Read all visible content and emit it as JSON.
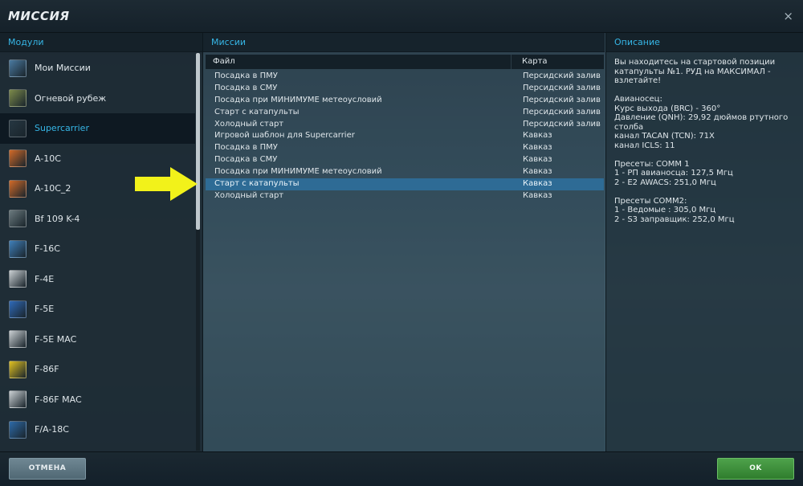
{
  "window": {
    "title": "МИССИЯ",
    "close_glyph": "×"
  },
  "modules": {
    "header": "Модули",
    "items": [
      {
        "label": "Мои Миссии",
        "icon": "my-missions-icon",
        "color": "#4a7aa0",
        "selected": false
      },
      {
        "label": "Огневой рубеж",
        "icon": "firing-range-icon",
        "color": "#7c8a4a",
        "selected": false
      },
      {
        "label": "Supercarrier",
        "icon": "supercarrier-icon",
        "color": "#263742",
        "selected": true
      },
      {
        "label": "A-10C",
        "icon": "a10c-icon",
        "color": "#d16a28",
        "selected": false
      },
      {
        "label": "A-10C_2",
        "icon": "a10c2-icon",
        "color": "#d16a28",
        "selected": false
      },
      {
        "label": "Bf 109 K-4",
        "icon": "bf109-icon",
        "color": "#6b7a7e",
        "selected": false
      },
      {
        "label": "F-16C",
        "icon": "f16c-icon",
        "color": "#3f7fb8",
        "selected": false
      },
      {
        "label": "F-4E",
        "icon": "f4e-icon",
        "color": "#c9cfd2",
        "selected": false
      },
      {
        "label": "F-5E",
        "icon": "f5e-icon",
        "color": "#2f6ab8",
        "selected": false
      },
      {
        "label": "F-5E MAC",
        "icon": "f5e-mac-icon",
        "color": "#c9cfd2",
        "selected": false
      },
      {
        "label": "F-86F",
        "icon": "f86f-icon",
        "color": "#e0c020",
        "selected": false
      },
      {
        "label": "F-86F MAC",
        "icon": "f86f-mac-icon",
        "color": "#c9cfd2",
        "selected": false
      },
      {
        "label": "F/A-18C",
        "icon": "fa18c-icon",
        "color": "#2d6aa8",
        "selected": false
      }
    ]
  },
  "missions": {
    "header": "Миссии",
    "columns": {
      "file": "Файл",
      "map": "Карта"
    },
    "rows": [
      {
        "name": "Посадка в ПМУ",
        "map": "Персидский залив",
        "selected": false
      },
      {
        "name": "Посадка в СМУ",
        "map": "Персидский залив",
        "selected": false
      },
      {
        "name": "Посадка при МИНИМУМЕ метеоусловий",
        "map": "Персидский залив",
        "selected": false
      },
      {
        "name": "Старт с катапульты",
        "map": "Персидский залив",
        "selected": false
      },
      {
        "name": "Холодный старт",
        "map": "Персидский залив",
        "selected": false
      },
      {
        "name": "Игровой шаблон для Supercarrier",
        "map": "Кавказ",
        "selected": false
      },
      {
        "name": "Посадка в ПМУ",
        "map": "Кавказ",
        "selected": false
      },
      {
        "name": "Посадка в СМУ",
        "map": "Кавказ",
        "selected": false
      },
      {
        "name": "Посадка при МИНИМУМЕ метеоусловий",
        "map": "Кавказ",
        "selected": false
      },
      {
        "name": "Старт с катапульты",
        "map": "Кавказ",
        "selected": true
      },
      {
        "name": "Холодный старт",
        "map": "Кавказ",
        "selected": false
      }
    ]
  },
  "description": {
    "header": "Описание",
    "paragraphs": [
      [
        "Вы находитесь на стартовой позиции",
        "катапульты №1. РУД на МАКСИМАЛ -",
        "взлетайте!"
      ],
      [
        "Авианосец:",
        "Курс выхода (BRC) - 360°",
        "Давление (QNH): 29,92 дюймов ртутного",
        "столба",
        "канал TACAN (TCN): 71X",
        "канал ICLS: 11"
      ],
      [
        "Пресеты: COMM 1",
        "1 - РП авианосца: 127,5 Мгц",
        "2 - E2 AWACS: 251,0 Мгц"
      ],
      [
        "Пресеты COMM2:",
        "1 - Ведомые : 305,0 Мгц",
        "2 - S3 заправщик: 252,0 Мгц"
      ]
    ]
  },
  "footer": {
    "cancel_label": "ОТМЕНА",
    "ok_label": "OK"
  },
  "colors": {
    "accent": "#36b6e6",
    "selection": "#2e6b95",
    "ok": "#3c8f39",
    "arrow": "#f2f21a"
  }
}
